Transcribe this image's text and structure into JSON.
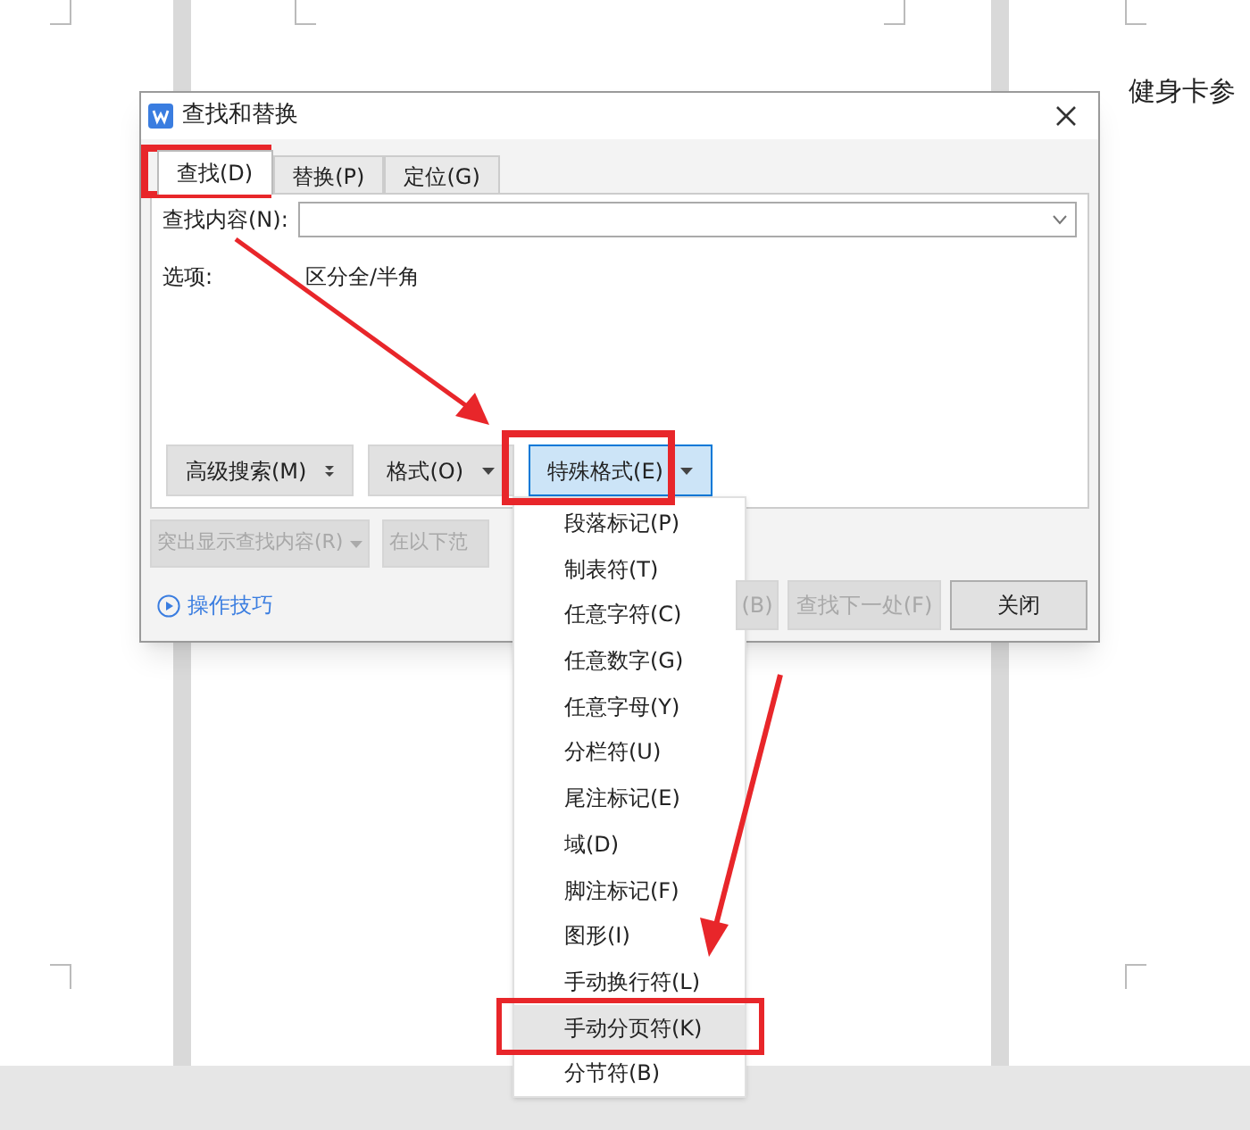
{
  "document": {
    "text": "健身卡参"
  },
  "dialog": {
    "title": "查找和替换",
    "tabs": [
      {
        "label": "查找(D)",
        "selected": true
      },
      {
        "label": "替换(P)",
        "selected": false
      },
      {
        "label": "定位(G)",
        "selected": false
      }
    ],
    "find_label": "查找内容(N):",
    "options_label": "选项:",
    "options_value": "区分全/半角",
    "buttons": [
      {
        "label": "高级搜索(M)",
        "kind": "double-caret",
        "selected": false
      },
      {
        "label": "格式(O)",
        "kind": "caret",
        "selected": false
      },
      {
        "label": "特殊格式(E)",
        "kind": "caret",
        "selected": true
      }
    ],
    "disabled_buttons": [
      {
        "label": "突出显示查找内容(R)",
        "disabled": true
      },
      {
        "label": "在以下范",
        "disabled": true
      }
    ],
    "tips_link": "操作技巧",
    "bottom_buttons": [
      {
        "label": "(B)",
        "disabled": true
      },
      {
        "label": "查找下一处(F)",
        "disabled": true
      },
      {
        "label": "关闭",
        "disabled": false
      }
    ]
  },
  "special_menu": {
    "items": [
      {
        "label": "段落标记(P)",
        "selected": false
      },
      {
        "label": "制表符(T)",
        "selected": false
      },
      {
        "label": "任意字符(C)",
        "selected": false
      },
      {
        "label": "任意数字(G)",
        "selected": false
      },
      {
        "label": "任意字母(Y)",
        "selected": false
      },
      {
        "label": "分栏符(U)",
        "selected": false
      },
      {
        "label": "尾注标记(E)",
        "selected": false
      },
      {
        "label": "域(D)",
        "selected": false
      },
      {
        "label": "脚注标记(F)",
        "selected": false
      },
      {
        "label": "图形(I)",
        "selected": false
      },
      {
        "label": "手动换行符(L)",
        "selected": false
      },
      {
        "label": "手动分页符(K)",
        "selected": true
      },
      {
        "label": "分节符(B)",
        "selected": false
      }
    ]
  }
}
